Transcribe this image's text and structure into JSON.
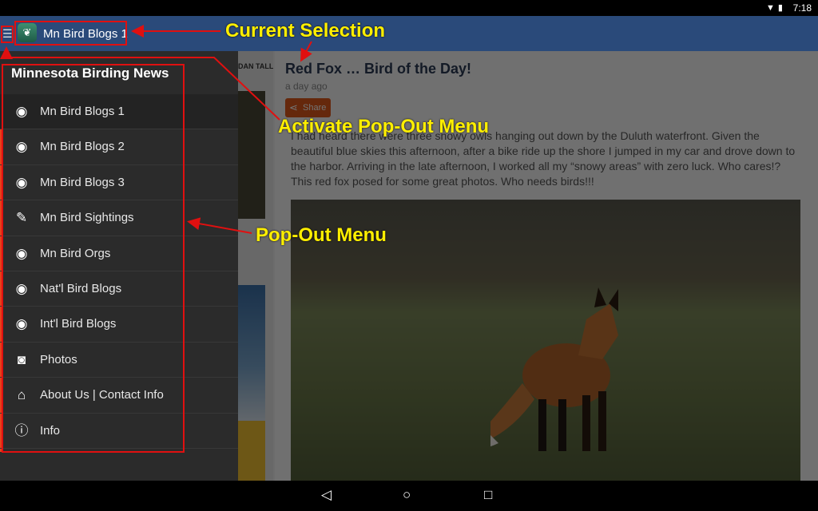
{
  "status_bar": {
    "time": "7:18",
    "icons": [
      "wifi-icon",
      "battery-icon"
    ]
  },
  "app_bar": {
    "title": "Mn Bird Blogs 1",
    "menu_icon": "hamburger-icon",
    "logo_icon": "tree-logo-icon"
  },
  "drawer": {
    "title": "Minnesota Birding News",
    "accent_color": "#e8401a",
    "items": [
      {
        "label": "Mn Bird Blogs 1",
        "icon": "rss-icon",
        "glyph": "◉",
        "active": true
      },
      {
        "label": "Mn Bird Blogs 2",
        "icon": "rss-icon",
        "glyph": "◉"
      },
      {
        "label": "Mn Bird Blogs 3",
        "icon": "rss-icon",
        "glyph": "◉"
      },
      {
        "label": "Mn Bird Sightings",
        "icon": "feather-icon",
        "glyph": "✎"
      },
      {
        "label": "Mn Bird Orgs",
        "icon": "rss-icon",
        "glyph": "◉"
      },
      {
        "label": "Nat'l Bird Blogs",
        "icon": "rss-icon",
        "glyph": "◉"
      },
      {
        "label": "Int'l Bird Blogs",
        "icon": "rss-icon",
        "glyph": "◉"
      },
      {
        "label": "Photos",
        "icon": "camera-icon",
        "glyph": "◙"
      },
      {
        "label": "About Us | Contact Info",
        "icon": "store-icon",
        "glyph": "⌂"
      },
      {
        "label": "Info",
        "icon": "info-icon",
        "glyph": "ⓘ"
      }
    ]
  },
  "list_column": {
    "tab_label": "DAN TALL"
  },
  "article": {
    "title": "Red Fox … Bird of the Day!",
    "date": "a day ago",
    "share_label": "Share",
    "body": "I had heard there were three snowy owls hanging out down by the Duluth waterfront. Given the beautiful blue skies this afternoon, after a bike ride up the shore I jumped in my car and drove down to the harbor. Arriving in the late afternoon, I worked all my “snowy areas” with zero luck. Who cares!? This red fox posed for some great photos. Who needs birds!!!"
  },
  "annotations": {
    "current_selection": "Current Selection",
    "activate_menu": "Activate Pop-Out Menu",
    "pop_out_menu": "Pop-Out Menu"
  },
  "nav_bar": {
    "back": "◁",
    "home": "○",
    "recents": "□"
  }
}
